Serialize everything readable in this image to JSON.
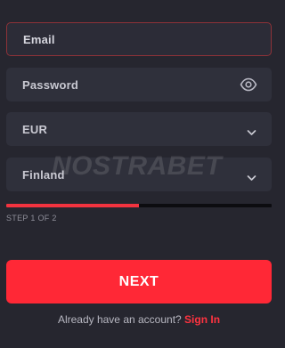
{
  "form": {
    "email": {
      "label": "Email"
    },
    "password": {
      "label": "Password",
      "icon": "eye-icon"
    },
    "currency": {
      "value": "EUR",
      "icon": "chevron-down-icon"
    },
    "country": {
      "value": "Finland",
      "icon": "chevron-down-icon"
    }
  },
  "watermark": {
    "text": "NOSTRABET"
  },
  "progress": {
    "fraction": 0.5,
    "step_text": "STEP 1 OF 2"
  },
  "next_button": {
    "label": "NEXT"
  },
  "signin": {
    "prompt": "Already have an account?",
    "link": "Sign In"
  },
  "colors": {
    "background": "#26262f",
    "field": "#2f303b",
    "accent": "#ff2836",
    "focus_border": "#8e3238"
  }
}
